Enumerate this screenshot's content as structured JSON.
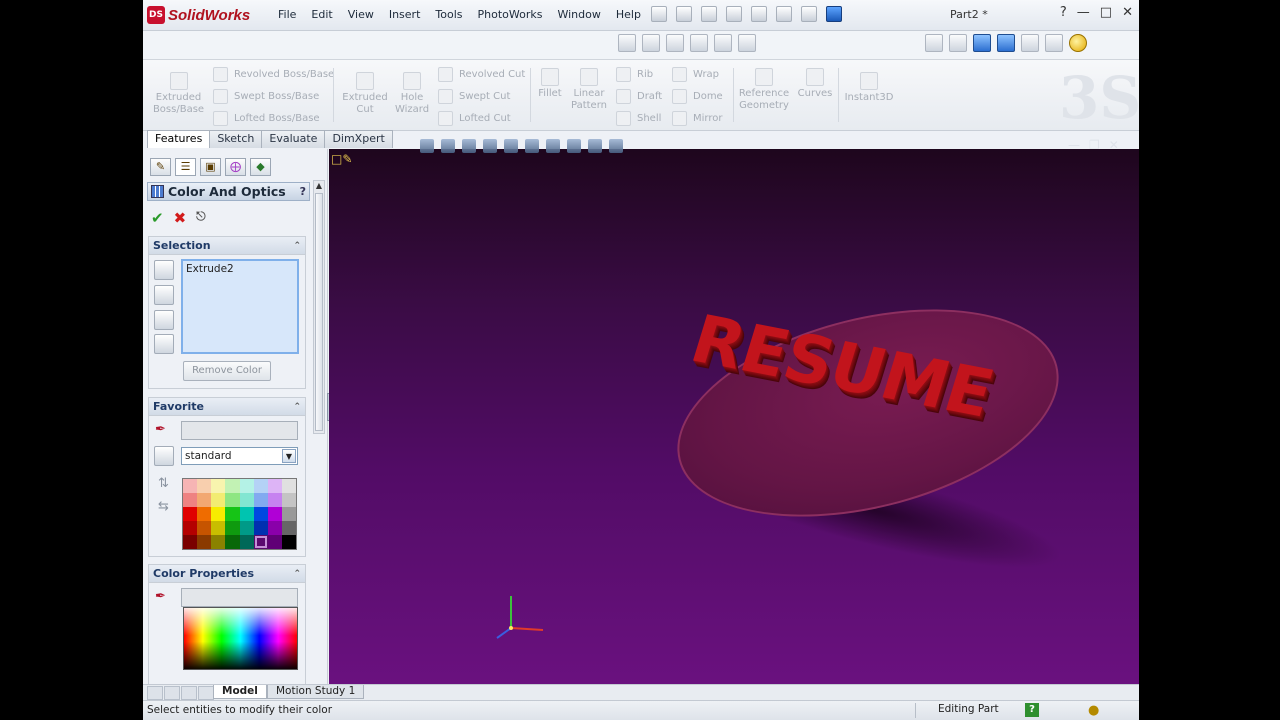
{
  "app": {
    "logo_text": "SolidWorks",
    "document_title": "Part2 *",
    "menu": [
      "File",
      "Edit",
      "View",
      "Insert",
      "Tools",
      "PhotoWorks",
      "Window",
      "Help"
    ],
    "window_controls": {
      "help": "?",
      "minimize": "—",
      "maximize": "□",
      "close": "✕"
    }
  },
  "command_manager": {
    "extruded_boss": "Extruded Boss/Base",
    "revolved_boss": "Revolved Boss/Base",
    "swept_boss": "Swept Boss/Base",
    "lofted_boss": "Lofted Boss/Base",
    "extruded_cut": "Extruded Cut",
    "hole_wizard": "Hole Wizard",
    "revolved_cut": "Revolved Cut",
    "swept_cut": "Swept Cut",
    "lofted_cut": "Lofted Cut",
    "fillet": "Fillet",
    "linear_pattern": "Linear Pattern",
    "rib": "Rib",
    "draft": "Draft",
    "shell": "Shell",
    "wrap": "Wrap",
    "dome": "Dome",
    "mirror": "Mirror",
    "reference_geometry": "Reference Geometry",
    "curves": "Curves",
    "instant3d": "Instant3D",
    "tabs": [
      "Features",
      "Sketch",
      "Evaluate",
      "DimXpert"
    ],
    "active_tab": "Features"
  },
  "property_manager": {
    "title": "Color And Optics",
    "help": "?",
    "selection": {
      "header": "Selection",
      "items": [
        "Extrude2"
      ],
      "remove_button": "Remove Color"
    },
    "favorite": {
      "header": "Favorite",
      "palette_value": "standard",
      "swatches": [
        "#f6b4b4",
        "#f8cfae",
        "#f8f4ae",
        "#c2f2b4",
        "#b4f2e6",
        "#b4d2f6",
        "#ddb4f6",
        "#e0e0e0",
        "#ee8282",
        "#f2a872",
        "#f2ec72",
        "#8ee682",
        "#82e6d2",
        "#82aaf0",
        "#c682f0",
        "#c4c4c4",
        "#e00000",
        "#ef6c00",
        "#f7ec00",
        "#16c416",
        "#00c4b0",
        "#0048e0",
        "#b000d6",
        "#999999",
        "#b40000",
        "#c65400",
        "#c8be00",
        "#0f9a0f",
        "#009a88",
        "#0030b0",
        "#8a00aa",
        "#666666",
        "#7a0000",
        "#8a3a00",
        "#8a8200",
        "#086808",
        "#006858",
        "#001e7a",
        "#600076",
        "#000000"
      ],
      "selected_swatch_color": "#5a0a6e"
    },
    "color_properties": {
      "header": "Color Properties"
    }
  },
  "viewport": {
    "model_text": "RESUME",
    "text_color": "#c2141c",
    "background_top": "#1e061d",
    "background_bottom": "#6a117f"
  },
  "bottom_tabs": [
    "Model",
    "Motion Study 1"
  ],
  "active_bottom_tab": "Model",
  "status": {
    "message": "Select entities to modify their color",
    "mode": "Editing Part"
  }
}
